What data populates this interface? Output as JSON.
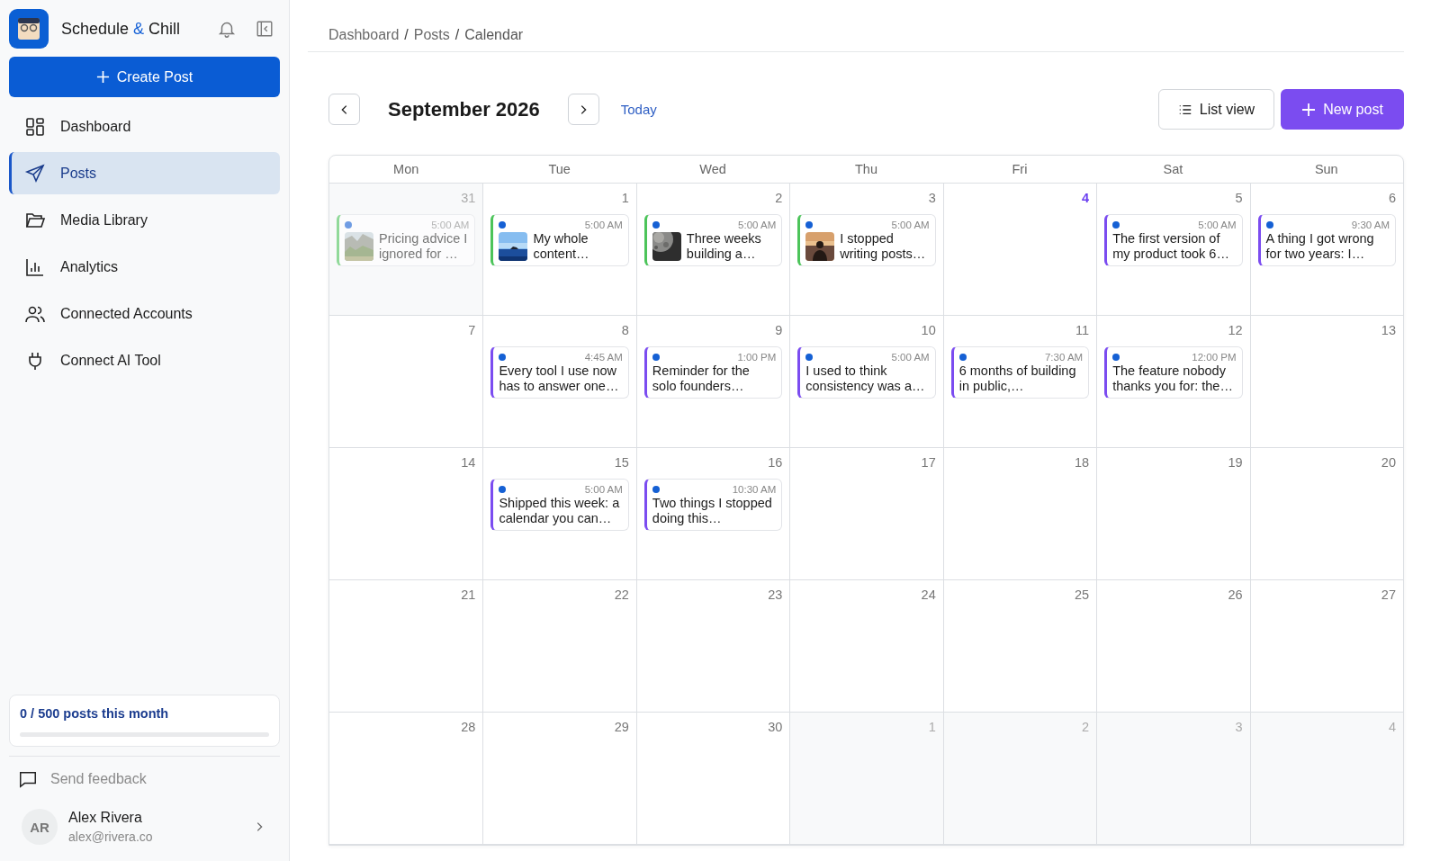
{
  "brand": {
    "name_start": "Schedule",
    "ampersand": "&",
    "name_end": "Chill"
  },
  "sidebar": {
    "create_button": "Create Post",
    "items": [
      {
        "kind": "dashboard",
        "label": "Dashboard",
        "selected": false
      },
      {
        "kind": "posts",
        "label": "Posts",
        "selected": true
      },
      {
        "kind": "media",
        "label": "Media Library",
        "selected": false
      },
      {
        "kind": "analytics",
        "label": "Analytics",
        "selected": false
      },
      {
        "kind": "accounts",
        "label": "Connected Accounts",
        "selected": false
      },
      {
        "kind": "plug",
        "label": "Connect AI Tool",
        "selected": false
      }
    ],
    "usage": {
      "text": "0 / 500 posts this month",
      "level": 0
    },
    "feedback": "Send feedback",
    "user": {
      "initials": "AR",
      "name": "Alex Rivera",
      "email": "alex@rivera.co"
    }
  },
  "breadcrumb": {
    "separator": "/",
    "items": [
      "Dashboard",
      "Posts",
      "Calendar"
    ]
  },
  "toolbar": {
    "month": "September 2026",
    "today": "Today",
    "list_view": "List view",
    "new_post": "New post"
  },
  "calendar": {
    "weekdays": [
      "Mon",
      "Tue",
      "Wed",
      "Thu",
      "Fri",
      "Sat",
      "Sun"
    ],
    "weeks": [
      [
        {
          "day": "31",
          "other_month": true,
          "today": false,
          "posts": [
            {
              "time": "5:00 AM",
              "text": "Pricing advice I ignored for …",
              "kind": "published",
              "thumbnail": true
            }
          ]
        },
        {
          "day": "1",
          "other_month": false,
          "today": false,
          "posts": [
            {
              "time": "5:00 AM",
              "text": "My whole content…",
              "kind": "published",
              "thumbnail": true
            }
          ]
        },
        {
          "day": "2",
          "other_month": false,
          "today": false,
          "posts": [
            {
              "time": "5:00 AM",
              "text": "Three weeks building a…",
              "kind": "published",
              "thumbnail": true
            }
          ]
        },
        {
          "day": "3",
          "other_month": false,
          "today": false,
          "posts": [
            {
              "time": "5:00 AM",
              "text": "I stopped writing posts…",
              "kind": "published",
              "thumbnail": true
            }
          ]
        },
        {
          "day": "4",
          "other_month": false,
          "today": true
        },
        {
          "day": "5",
          "other_month": false,
          "today": false,
          "posts": [
            {
              "time": "5:00 AM",
              "text": "The first version of my product took 6…",
              "kind": "scheduled",
              "thumbnail": false
            }
          ]
        },
        {
          "day": "6",
          "other_month": false,
          "today": false,
          "posts": [
            {
              "time": "9:30 AM",
              "text": "A thing I got wrong for two years: I…",
              "kind": "scheduled",
              "thumbnail": false
            }
          ]
        }
      ],
      [
        {
          "day": "7",
          "other_month": false,
          "today": false
        },
        {
          "day": "8",
          "other_month": false,
          "today": false,
          "posts": [
            {
              "time": "4:45 AM",
              "text": "Every tool I use now has to answer one…",
              "kind": "scheduled",
              "thumbnail": false
            }
          ]
        },
        {
          "day": "9",
          "other_month": false,
          "today": false,
          "posts": [
            {
              "time": "1:00 PM",
              "text": "Reminder for the solo founders…",
              "kind": "scheduled",
              "thumbnail": false
            }
          ]
        },
        {
          "day": "10",
          "other_month": false,
          "today": false,
          "posts": [
            {
              "time": "5:00 AM",
              "text": "I used to think consistency was a…",
              "kind": "scheduled",
              "thumbnail": false
            }
          ]
        },
        {
          "day": "11",
          "other_month": false,
          "today": false,
          "posts": [
            {
              "time": "7:30 AM",
              "text": "6 months of building in public,…",
              "kind": "scheduled",
              "thumbnail": false
            }
          ]
        },
        {
          "day": "12",
          "other_month": false,
          "today": false,
          "posts": [
            {
              "time": "12:00 PM",
              "text": "The feature nobody thanks you for: the…",
              "kind": "scheduled",
              "thumbnail": false
            }
          ]
        },
        {
          "day": "13",
          "other_month": false,
          "today": false
        }
      ],
      [
        {
          "day": "14",
          "other_month": false,
          "today": false
        },
        {
          "day": "15",
          "other_month": false,
          "today": false,
          "posts": [
            {
              "time": "5:00 AM",
              "text": "Shipped this week: a calendar you can…",
              "kind": "scheduled",
              "thumbnail": false
            }
          ]
        },
        {
          "day": "16",
          "other_month": false,
          "today": false,
          "posts": [
            {
              "time": "10:30 AM",
              "text": "Two things I stopped doing this…",
              "kind": "scheduled",
              "thumbnail": false
            }
          ]
        },
        {
          "day": "17",
          "other_month": false,
          "today": false
        },
        {
          "day": "18",
          "other_month": false,
          "today": false
        },
        {
          "day": "19",
          "other_month": false,
          "today": false
        },
        {
          "day": "20",
          "other_month": false,
          "today": false
        }
      ],
      [
        {
          "day": "21",
          "other_month": false,
          "today": false
        },
        {
          "day": "22",
          "other_month": false,
          "today": false
        },
        {
          "day": "23",
          "other_month": false,
          "today": false
        },
        {
          "day": "24",
          "other_month": false,
          "today": false
        },
        {
          "day": "25",
          "other_month": false,
          "today": false
        },
        {
          "day": "26",
          "other_month": false,
          "today": false
        },
        {
          "day": "27",
          "other_month": false,
          "today": false
        }
      ],
      [
        {
          "day": "28",
          "other_month": false,
          "today": false
        },
        {
          "day": "29",
          "other_month": false,
          "today": false
        },
        {
          "day": "30",
          "other_month": false,
          "today": false
        },
        {
          "day": "1",
          "other_month": true,
          "today": false
        },
        {
          "day": "2",
          "other_month": true,
          "today": false
        },
        {
          "day": "3",
          "other_month": true,
          "today": false
        },
        {
          "day": "4",
          "other_month": true,
          "today": false
        }
      ]
    ]
  }
}
